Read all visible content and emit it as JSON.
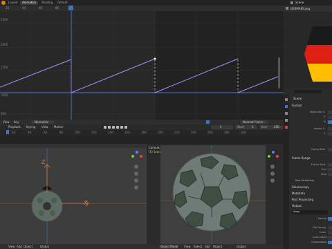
{
  "topbar": {
    "tabs": [
      {
        "label": "Layout"
      },
      {
        "label": "Animation"
      },
      {
        "label": "Shading"
      },
      {
        "label": "Default"
      }
    ],
    "scene_label": "Scene"
  },
  "graph_editor": {
    "y_ticks": [
      "2500",
      "2000",
      "1500",
      "1000",
      "500",
      "0",
      "-500"
    ],
    "x_ticks": [
      "0",
      "20",
      "40",
      "60",
      "80",
      "100",
      "120",
      "140",
      "160",
      "180",
      "200",
      "220",
      "240",
      "260",
      "280",
      "300",
      "320"
    ],
    "current_frame_marker": "80",
    "menu": [
      "View",
      "Key",
      "Normalize"
    ],
    "right_menu": [
      "Nearest Frame"
    ],
    "curve_color": "#b08cff",
    "baseline_color": "#4b7bd6"
  },
  "timeline": {
    "menu": [
      "Playback",
      "Keying",
      "View",
      "Marker"
    ],
    "current_frame": "1",
    "start_label": "Start",
    "start_value": "1",
    "end_label": "End",
    "end_value": "250",
    "ruler_ticks": [
      "0",
      "20",
      "40",
      "60",
      "80",
      "100",
      "120",
      "140",
      "160",
      "180",
      "200",
      "220",
      "240",
      "260",
      "280",
      "300"
    ]
  },
  "image_editor": {
    "filename": "GERMANY.png",
    "flag_colors": [
      "#1a1a1a",
      "#dd1f14",
      "#ffbe00"
    ]
  },
  "properties": {
    "scene_name": "Scene",
    "sections": {
      "format": "Format",
      "frame_range": "Frame Range",
      "time_stretching": "Time Stretching",
      "stereoscopy": "Stereoscopy",
      "metadata": "Metadata",
      "post_processing": "Post Processing",
      "output": "Output"
    },
    "fields": {
      "resolution_x": "Resolution X",
      "y_label": "Y",
      "percent": "%",
      "aspect_x": "Aspect X",
      "frame_rate": "Frame Rate",
      "frame_start": "Frame Start",
      "end": "End",
      "step": "Step",
      "output_path": "/tmp\\",
      "saving": "Saving",
      "file_format": "File Format",
      "color": "Color",
      "color_depth": "Color Depth",
      "compression": "Compression"
    }
  },
  "viewport_left": {
    "axis_z": "Z",
    "axis_x": "X",
    "menu": [
      "View",
      "Add",
      "Object"
    ],
    "global": "Global"
  },
  "viewport_right": {
    "title": "Camera Perspective",
    "subtitle": "(1) Scene Collection | Empty",
    "mode": "Object Mode",
    "menu": [
      "View",
      "Select",
      "Add",
      "Object"
    ],
    "global": "Global"
  },
  "colors": {
    "accent": "#4772b3",
    "background": "#1d1d1d",
    "panel": "#303030",
    "header": "#232323"
  }
}
